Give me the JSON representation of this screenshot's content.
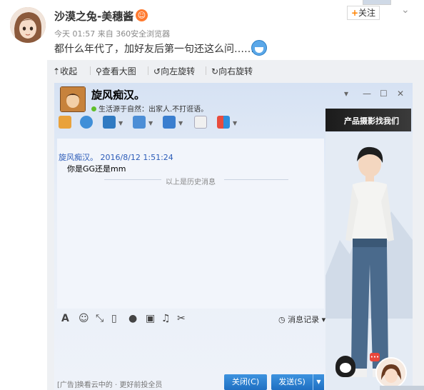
{
  "post": {
    "username": "沙漠之兔-美穗酱",
    "meta": "今天 01:57 来自 360安全浏览器",
    "text": "都什么年代了，加好友后第一句还这么问……",
    "follow_label": "关注",
    "follow_plus": "+"
  },
  "image_toolbar": {
    "collapse": "收起",
    "view_large": "查看大图",
    "rotate_left": "向左旋转",
    "rotate_right": "向右旋转"
  },
  "qq_window": {
    "title": "旋风痴汉。",
    "status": "生活源于自然：出家人.不打诳语。",
    "ad_banner": "产品摄影找我们",
    "message": {
      "sender_time": "旋风痴汉。  2016/8/12 1:51:24",
      "body": "你是GG还是mm"
    },
    "history_label": "以上是历史消息",
    "msg_record": "消息记录",
    "ad_text": "[广告]换看云中的 · 更好前投全员",
    "close_label": "关闭(C)",
    "send_label": "发送(S)"
  }
}
